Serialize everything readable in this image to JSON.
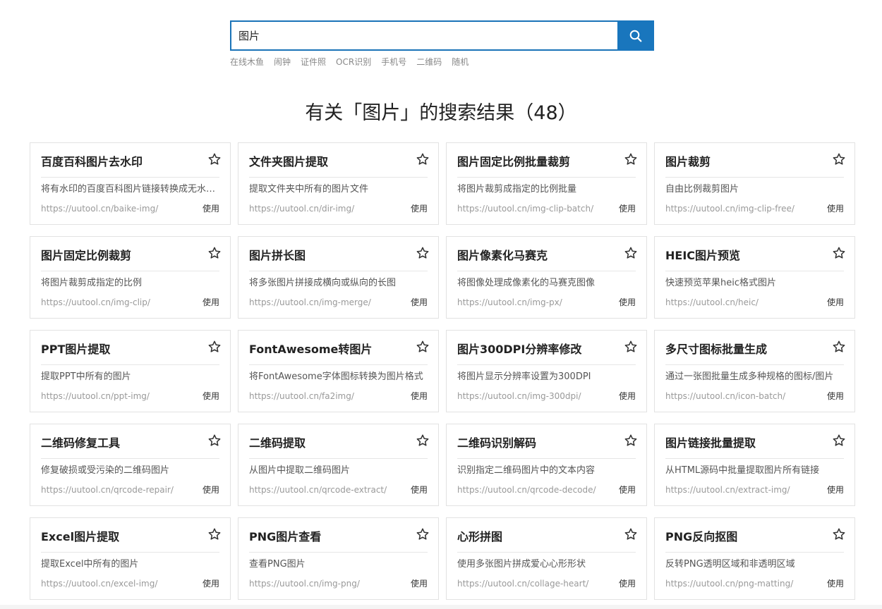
{
  "search": {
    "value": "图片",
    "placeholder": "",
    "button_icon": "search-icon"
  },
  "hot_links": [
    "在线木鱼",
    "闹钟",
    "证件照",
    "OCR识别",
    "手机号",
    "二维码",
    "随机"
  ],
  "results_title": "有关「图片」的搜索结果（48）",
  "colors": {
    "accent": "#1976bd",
    "card_border": "#e2e2e2"
  },
  "use_label": "使用",
  "cards": [
    {
      "title": "百度百科图片去水印",
      "desc": "将有水印的百度百科图片链接转换成无水印图片",
      "url": "https://uutool.cn/baike-img/"
    },
    {
      "title": "文件夹图片提取",
      "desc": "提取文件夹中所有的图片文件",
      "url": "https://uutool.cn/dir-img/"
    },
    {
      "title": "图片固定比例批量裁剪",
      "desc": "将图片裁剪成指定的比例批量",
      "url": "https://uutool.cn/img-clip-batch/"
    },
    {
      "title": "图片裁剪",
      "desc": "自由比例裁剪图片",
      "url": "https://uutool.cn/img-clip-free/"
    },
    {
      "title": "图片固定比例裁剪",
      "desc": "将图片裁剪成指定的比例",
      "url": "https://uutool.cn/img-clip/"
    },
    {
      "title": "图片拼长图",
      "desc": "将多张图片拼接成横向或纵向的长图",
      "url": "https://uutool.cn/img-merge/"
    },
    {
      "title": "图片像素化马赛克",
      "desc": "将图像处理成像素化的马赛克图像",
      "url": "https://uutool.cn/img-px/"
    },
    {
      "title": "HEIC图片预览",
      "desc": "快速预览苹果heic格式图片",
      "url": "https://uutool.cn/heic/"
    },
    {
      "title": "PPT图片提取",
      "desc": "提取PPT中所有的图片",
      "url": "https://uutool.cn/ppt-img/"
    },
    {
      "title": "FontAwesome转图片",
      "desc": "将FontAwesome字体图标转换为图片格式",
      "url": "https://uutool.cn/fa2img/"
    },
    {
      "title": "图片300DPI分辨率修改",
      "desc": "将图片显示分辨率设置为300DPI",
      "url": "https://uutool.cn/img-300dpi/"
    },
    {
      "title": "多尺寸图标批量生成",
      "desc": "通过一张图批量生成多种规格的图标/图片",
      "url": "https://uutool.cn/icon-batch/"
    },
    {
      "title": "二维码修复工具",
      "desc": "修复破损或受污染的二维码图片",
      "url": "https://uutool.cn/qrcode-repair/"
    },
    {
      "title": "二维码提取",
      "desc": "从图片中提取二维码图片",
      "url": "https://uutool.cn/qrcode-extract/"
    },
    {
      "title": "二维码识别解码",
      "desc": "识别指定二维码图片中的文本内容",
      "url": "https://uutool.cn/qrcode-decode/"
    },
    {
      "title": "图片链接批量提取",
      "desc": "从HTML源码中批量提取图片所有链接",
      "url": "https://uutool.cn/extract-img/"
    },
    {
      "title": "Excel图片提取",
      "desc": "提取Excel中所有的图片",
      "url": "https://uutool.cn/excel-img/"
    },
    {
      "title": "PNG图片查看",
      "desc": "查看PNG图片",
      "url": "https://uutool.cn/img-png/"
    },
    {
      "title": "心形拼图",
      "desc": "使用多张图片拼成爱心心形形状",
      "url": "https://uutool.cn/collage-heart/"
    },
    {
      "title": "PNG反向抠图",
      "desc": "反转PNG透明区域和非透明区域",
      "url": "https://uutool.cn/png-matting/"
    }
  ]
}
